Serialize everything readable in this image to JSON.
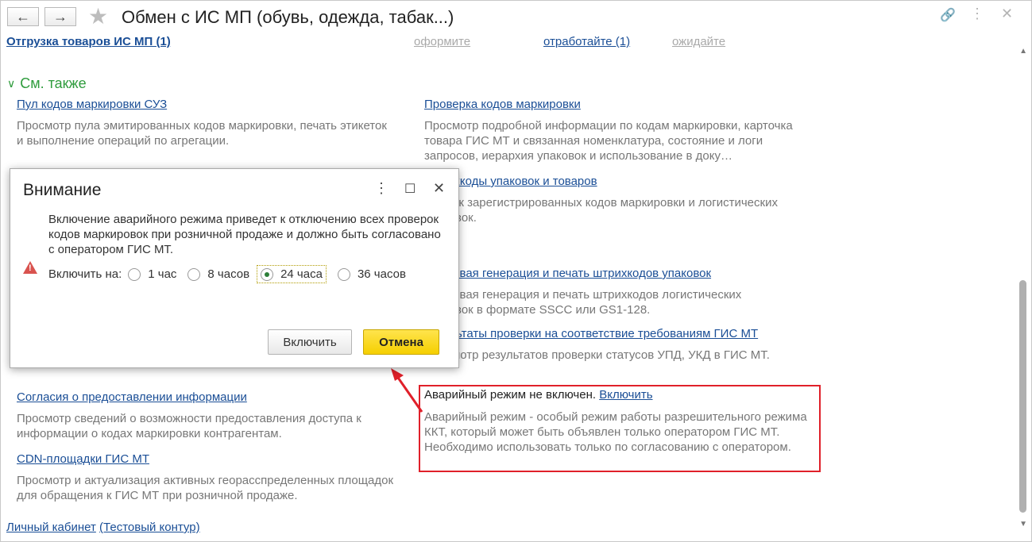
{
  "window": {
    "title": "Обмен с ИС МП (обувь, одежда, табак...)"
  },
  "top_nav": {
    "shipment": "Отгрузка товаров ИС МП (1)",
    "make": "оформите",
    "process": "отработайте (1)",
    "wait": "ожидайте"
  },
  "see_also": {
    "label": "См. также",
    "items": [
      {
        "link": "Пул кодов маркировки СУЗ",
        "desc": "Просмотр пула эмитированных кодов маркировки, печать этикеток и выполнение операций по агрегации."
      },
      {
        "link": "Проверка кодов маркировки",
        "desc": "Просмотр подробной информации по кодам маркировки, карточка товара ГИС МТ и связанная номенклатура, состояние и логи запросов, иерархия упаковок и использование в доку…"
      },
      {
        "link": "Штрихкоды упаковок и товаров",
        "desc": "Список зарегистрированных кодов маркировки и логистических упаковок."
      },
      {
        "link": "Массовая генерация и печать штрихкодов упаковок",
        "desc": "Массовая генерация и печать штрихкодов логистических упаковок в формате SSCC или GS1-128."
      },
      {
        "link": "Результаты проверки на соответствие требованиям ГИС МТ",
        "desc": "Просмотр результатов проверки статусов УПД, УКД в ГИС МТ."
      },
      {
        "link": "Согласия о предоставлении информации",
        "desc": "Просмотр сведений о возможности предоставления доступа к информации о кодах маркировки контрагентам."
      },
      {
        "link": "CDN-площадки ГИС МТ",
        "desc": "Просмотр и актуализация активных георасспределенных площадок для обращения к ГИС МТ при розничной продаже."
      }
    ]
  },
  "emergency": {
    "status": "Аварийный режим не включен.",
    "enable_link": "Включить",
    "desc": "Аварийный режим - особый режим работы разрешительного режима ККТ, который может быть объявлен только оператором ГИС МТ. Необходимо использовать только по согласованию с оператором."
  },
  "footer": {
    "cabinet": "Личный кабинет",
    "test": "(Тестовый контур)"
  },
  "dialog": {
    "title": "Внимание",
    "message": "Включение аварийного режима приведет к отключению всех проверок кодов маркировок при розничной продаже и должно быть согласовано с оператором ГИС МТ.",
    "enable_on_label": "Включить на:",
    "options": [
      "1 час",
      "8 часов",
      "24 часа",
      "36 часов"
    ],
    "selected": "24 часа",
    "btn_enable": "Включить",
    "btn_cancel": "Отмена"
  },
  "colors": {
    "link": "#1a4e96",
    "section": "#2f9c3d",
    "cancel_button": "#f5cf00",
    "highlight": "#e0202a"
  }
}
